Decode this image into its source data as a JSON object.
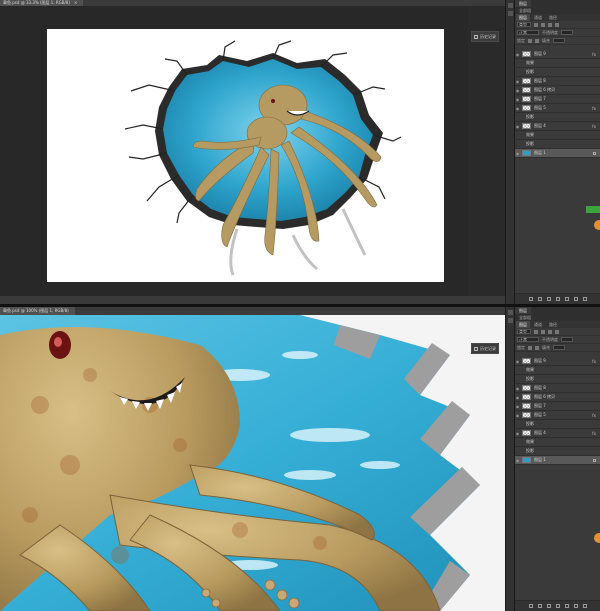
{
  "top_window": {
    "doc_tab": "章鱼.psd @ 33.3% (图层 1, RGB/8)",
    "close_glyph": "×",
    "history_button": "历史记录",
    "panel_title": "图层",
    "panel_subtitle": "全部组",
    "panel_tabs": [
      "图层",
      "通道",
      "路径"
    ],
    "filter_label": "类型",
    "blend_mode": "正常",
    "opacity_label": "不透明度",
    "lock_label": "锁定",
    "fill_label": "填充",
    "layers": [
      {
        "name": "图层 9",
        "fx": true,
        "selected": false,
        "sub": false,
        "lock": false
      },
      {
        "name": "效果",
        "fx": false,
        "selected": false,
        "sub": true,
        "lock": false
      },
      {
        "name": "投影",
        "fx": false,
        "selected": false,
        "sub": true,
        "lock": false
      },
      {
        "name": "图层 8",
        "fx": false,
        "selected": false,
        "sub": false,
        "lock": false
      },
      {
        "name": "图层 6 拷贝",
        "fx": false,
        "selected": false,
        "sub": false,
        "lock": false
      },
      {
        "name": "图层 7",
        "fx": false,
        "selected": false,
        "sub": false,
        "lock": false
      },
      {
        "name": "图层 5",
        "fx": true,
        "selected": false,
        "sub": false,
        "lock": false
      },
      {
        "name": "投影",
        "fx": false,
        "selected": false,
        "sub": true,
        "lock": false
      },
      {
        "name": "图层 4",
        "fx": true,
        "selected": false,
        "sub": false,
        "lock": false
      },
      {
        "name": "效果",
        "fx": false,
        "selected": false,
        "sub": true,
        "lock": false
      },
      {
        "name": "投影",
        "fx": false,
        "selected": false,
        "sub": true,
        "lock": false
      },
      {
        "name": "图层 1",
        "fx": false,
        "selected": true,
        "sub": false,
        "lock": true
      }
    ]
  },
  "bottom_window": {
    "doc_tab": "章鱼.psd @ 100% (图层 1, RGB/8)",
    "history_button": "历史记录",
    "panel_title": "图层",
    "panel_subtitle": "全部组",
    "panel_tabs": [
      "图层",
      "通道",
      "路径"
    ],
    "filter_label": "类型",
    "blend_mode": "正常",
    "opacity_label": "不透明度",
    "lock_label": "锁定",
    "fill_label": "填充",
    "layers": [
      {
        "name": "图层 9",
        "fx": true,
        "selected": false,
        "sub": false,
        "lock": false
      },
      {
        "name": "效果",
        "fx": false,
        "selected": false,
        "sub": true,
        "lock": false
      },
      {
        "name": "投影",
        "fx": false,
        "selected": false,
        "sub": true,
        "lock": false
      },
      {
        "name": "图层 8",
        "fx": false,
        "selected": false,
        "sub": false,
        "lock": false
      },
      {
        "name": "图层 6 拷贝",
        "fx": false,
        "selected": false,
        "sub": false,
        "lock": false
      },
      {
        "name": "图层 7",
        "fx": false,
        "selected": false,
        "sub": false,
        "lock": false
      },
      {
        "name": "图层 5",
        "fx": true,
        "selected": false,
        "sub": false,
        "lock": false
      },
      {
        "name": "投影",
        "fx": false,
        "selected": false,
        "sub": true,
        "lock": false
      },
      {
        "name": "图层 4",
        "fx": true,
        "selected": false,
        "sub": false,
        "lock": false
      },
      {
        "name": "效果",
        "fx": false,
        "selected": false,
        "sub": true,
        "lock": false
      },
      {
        "name": "投影",
        "fx": false,
        "selected": false,
        "sub": true,
        "lock": false
      },
      {
        "name": "图层 1",
        "fx": false,
        "selected": true,
        "sub": false,
        "lock": true
      }
    ]
  },
  "icons": {
    "eye": "◉",
    "fx": "fx"
  },
  "colors": {
    "app_bg": "#262626",
    "panel_bg": "#3a3a3a",
    "water": "#2fa6c9",
    "octopus": "#b59a62",
    "artboard": "#ffffff"
  }
}
